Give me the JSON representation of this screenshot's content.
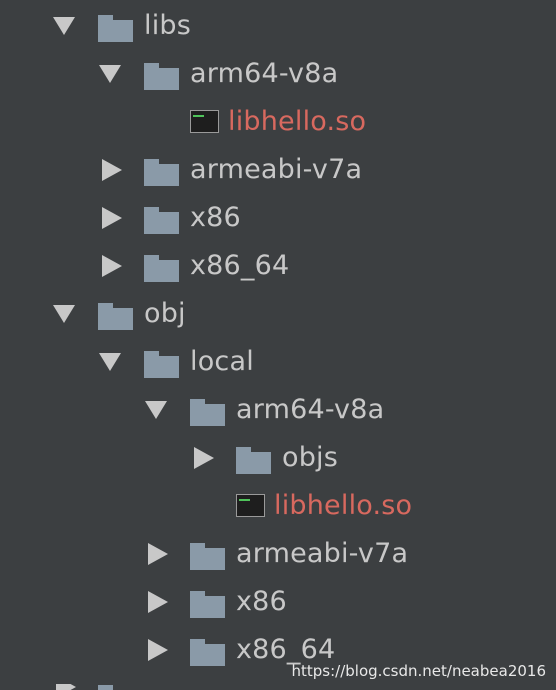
{
  "project_tree": {
    "rows": [
      {
        "name": "libs",
        "type": "folder",
        "state": "expanded"
      },
      {
        "name": "arm64-v8a",
        "type": "folder",
        "state": "expanded"
      },
      {
        "name": "libhello.so",
        "type": "file",
        "icon": "shared-library-icon",
        "color": "#d8695f"
      },
      {
        "name": "armeabi-v7a",
        "type": "folder",
        "state": "collapsed"
      },
      {
        "name": "x86",
        "type": "folder",
        "state": "collapsed"
      },
      {
        "name": "x86_64",
        "type": "folder",
        "state": "collapsed"
      },
      {
        "name": "obj",
        "type": "folder",
        "state": "expanded"
      },
      {
        "name": "local",
        "type": "folder",
        "state": "expanded"
      },
      {
        "name": "arm64-v8a",
        "type": "folder",
        "state": "expanded"
      },
      {
        "name": "objs",
        "type": "folder",
        "state": "collapsed"
      },
      {
        "name": "libhello.so",
        "type": "file",
        "icon": "shared-library-icon",
        "color": "#d8695f"
      },
      {
        "name": "armeabi-v7a",
        "type": "folder",
        "state": "collapsed"
      },
      {
        "name": "x86",
        "type": "folder",
        "state": "collapsed"
      },
      {
        "name": "x86_64",
        "type": "folder",
        "state": "collapsed"
      }
    ]
  },
  "watermark": "https://blog.csdn.net/neabea2016",
  "colors": {
    "background": "#3c3f41",
    "text": "#c8c8c8",
    "excluded_text": "#d8695f",
    "folder": "#8a9aa8",
    "arrow": "#c8c8c8"
  }
}
